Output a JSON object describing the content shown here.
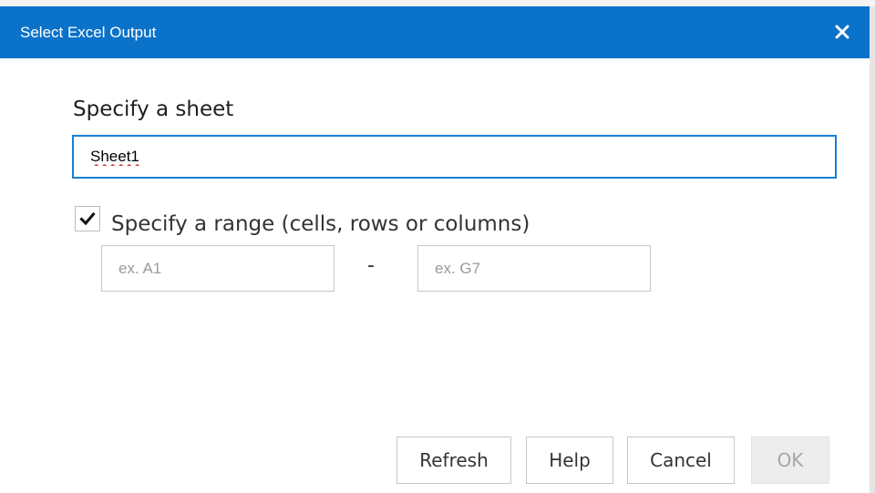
{
  "dialog": {
    "title": "Select Excel Output",
    "close_icon": "close-icon",
    "accent_color": "#0b72c9"
  },
  "sheet": {
    "label": "Specify a sheet",
    "value": "Sheet1"
  },
  "range": {
    "checked": true,
    "label": "Specify a range (cells, rows or columns)",
    "start_placeholder": "ex. A1",
    "start_value": "",
    "separator": "-",
    "end_placeholder": "ex. G7",
    "end_value": ""
  },
  "buttons": {
    "refresh": "Refresh",
    "help": "Help",
    "cancel": "Cancel",
    "ok": "OK"
  }
}
